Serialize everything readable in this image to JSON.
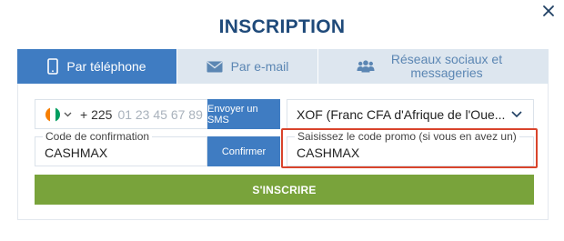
{
  "dialog": {
    "title": "INSCRIPTION",
    "close_icon": "close-icon"
  },
  "tabs": [
    {
      "label": "Par téléphone",
      "icon": "phone-icon",
      "active": true
    },
    {
      "label": "Par e-mail",
      "icon": "envelope-icon",
      "active": false
    },
    {
      "label": "Réseaux sociaux et messageries",
      "icon": "people-icon",
      "active": false
    }
  ],
  "phone": {
    "country_flag": "ivory-coast-flag",
    "country_code": "+ 225",
    "placeholder": "01 23 45 67 89",
    "send_sms_label": "Envoyer un SMS"
  },
  "currency": {
    "value": "XOF (Franc CFA d'Afrique de l'Oue..."
  },
  "confirmation": {
    "label": "Code de confirmation",
    "value": "CASHMAX",
    "button_label": "Confirmer"
  },
  "promo": {
    "label": "Saisissez le code promo (si vous en avez un)",
    "value": "CASHMAX"
  },
  "submit": {
    "label": "S'INSCRIRE"
  },
  "colors": {
    "title": "#1f4a7a",
    "tab_active": "#3f7cc2",
    "tab_inactive": "#dde6ef",
    "button_blue": "#3f7cc2",
    "submit_green": "#79a33b",
    "highlight_red": "#d9442c"
  }
}
